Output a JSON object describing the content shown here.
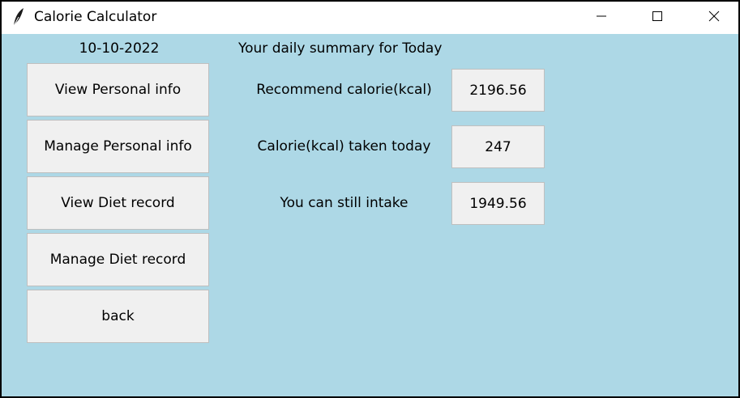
{
  "window": {
    "title": "Calorie Calculator",
    "title_icon": "feather-icon",
    "controls": [
      "minimize-icon",
      "maximize-icon",
      "close-icon"
    ]
  },
  "header": {
    "date": "10-10-2022",
    "summary_title": "Your daily summary for Today"
  },
  "menu": {
    "items": [
      {
        "label": "View Personal info"
      },
      {
        "label": "Manage Personal info"
      },
      {
        "label": "View Diet record"
      },
      {
        "label": "Manage Diet record"
      },
      {
        "label": "back"
      }
    ]
  },
  "summary": {
    "rows": [
      {
        "label": "Recommend calorie(kcal)",
        "value": "2196.56"
      },
      {
        "label": "Calorie(kcal) taken today",
        "value": "247"
      },
      {
        "label": "You can still intake",
        "value": "1949.56"
      }
    ]
  },
  "colors": {
    "background": "#add8e6",
    "button": "#f0f0f0"
  }
}
